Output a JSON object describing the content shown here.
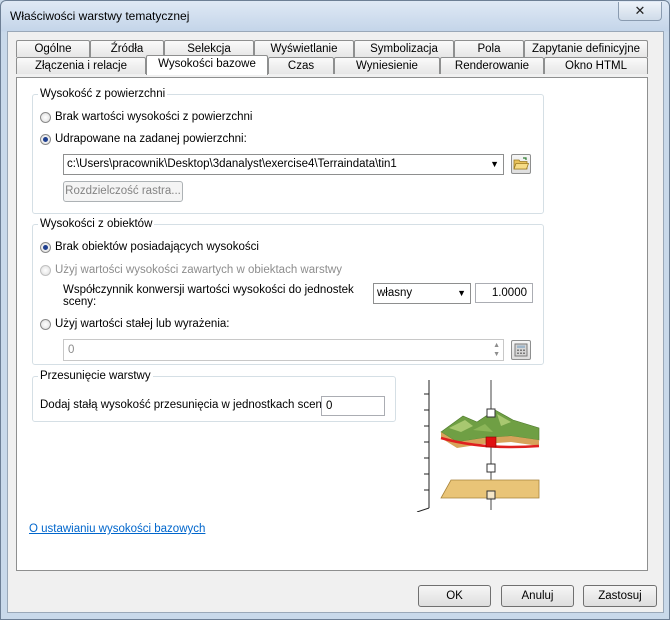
{
  "window": {
    "title": "Właściwości warstwy tematycznej",
    "close_glyph": "✕"
  },
  "tabs": {
    "row1": [
      "Ogólne",
      "Źródła",
      "Selekcja",
      "Wyświetlanie",
      "Symbolizacja",
      "Pola",
      "Zapytanie definicyjne"
    ],
    "row2": [
      "Złączenia i relacje",
      "Wysokości bazowe",
      "Czas",
      "Wyniesienie",
      "Renderowanie",
      "Okno HTML"
    ],
    "active": "Wysokości bazowe"
  },
  "surface_group": {
    "legend": "Wysokość z powierzchni",
    "option_none": "Brak wartości wysokości z powierzchni",
    "option_draped": "Udrapowane na zadanej powierzchni:",
    "surface_path": "c:\\Users\\pracownik\\Desktop\\3danalyst\\exercise4\\Terraindata\\tin1",
    "raster_resolution_button": "Rozdzielczość rastra..."
  },
  "features_group": {
    "legend": "Wysokości z obiektów",
    "option_none": "Brak obiektów posiadających wysokości",
    "option_use_values": "Użyj wartości wysokości zawartych w obiektach warstwy",
    "conversion_label_line1": "Współczynnik konwersji wartości wysokości do jednostek",
    "conversion_label_line2": "sceny:",
    "conversion_unit": "własny",
    "conversion_value": "1.0000",
    "option_expression": "Użyj wartości stałej lub wyrażenia:",
    "expression_value": "0"
  },
  "offset_group": {
    "legend": "Przesunięcie warstwy",
    "offset_label": "Dodaj stałą wysokość przesunięcia w jednostkach sceny:",
    "offset_value": "0"
  },
  "help_link": "O ustawianiu wysokości bazowych",
  "buttons": {
    "ok": "OK",
    "cancel": "Anuluj",
    "apply": "Zastosuj"
  }
}
